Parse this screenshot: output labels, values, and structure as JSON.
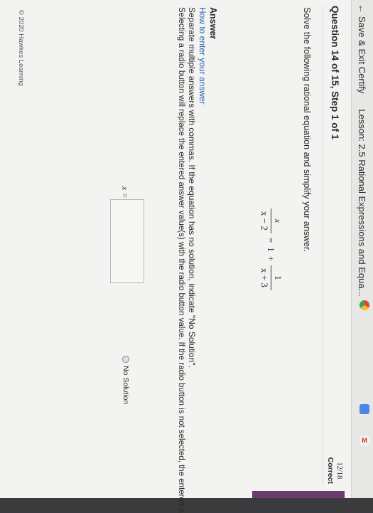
{
  "topbar": {
    "back_icon": "←",
    "save_exit": "Save & Exit Certify",
    "lesson": "Lesson: 2.5 Rational Expressions and Equa..."
  },
  "question": {
    "title": "Question 14 of 15, Step 1 of 1",
    "score": "12/18",
    "score_label": "Correct",
    "instruction": "Solve the following rational equation and simplify your answer.",
    "equation": {
      "lhs_num": "x",
      "lhs_den": "x − 2",
      "eq": "=",
      "one": "1",
      "plus": "+",
      "rhs_num": "1",
      "rhs_den": "x + 3"
    }
  },
  "answer": {
    "heading": "Answer",
    "how_link": "How to enter your answer",
    "separate_text": "Separate multiple answers with commas. If the equation has no solution, indicate \"No Solution\".",
    "radio_text": "Selecting a radio button will replace the entered answer value(s) with the radio button value. If the radio button is not selected, the entered a",
    "x_label": "x =",
    "input_value": "",
    "no_solution": "No Solution"
  },
  "footer": {
    "copyright": "© 2020 Hawkes Learning"
  },
  "colors": {
    "accent_link": "#2f65b8",
    "progress": "#6a3b6e",
    "background": "#f3f3f1"
  },
  "taskbar": {
    "icons": [
      "chrome-icon",
      "docs-icon",
      "gmail-icon"
    ]
  }
}
